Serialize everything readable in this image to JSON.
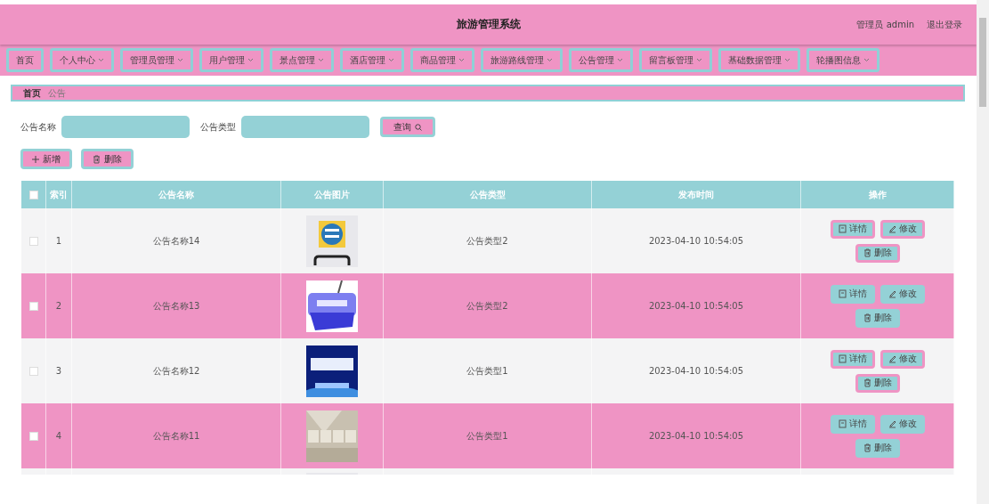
{
  "header": {
    "title": "旅游管理系统",
    "user": "管理员 admin",
    "logout": "退出登录"
  },
  "nav": [
    {
      "label": "首页",
      "dropdown": false
    },
    {
      "label": "个人中心",
      "dropdown": true
    },
    {
      "label": "管理员管理",
      "dropdown": true
    },
    {
      "label": "用户管理",
      "dropdown": true
    },
    {
      "label": "景点管理",
      "dropdown": true
    },
    {
      "label": "酒店管理",
      "dropdown": true
    },
    {
      "label": "商品管理",
      "dropdown": true
    },
    {
      "label": "旅游路线管理",
      "dropdown": true
    },
    {
      "label": "公告管理",
      "dropdown": true
    },
    {
      "label": "留言板管理",
      "dropdown": true
    },
    {
      "label": "基础数据管理",
      "dropdown": true
    },
    {
      "label": "轮播图信息",
      "dropdown": true
    }
  ],
  "breadcrumb": [
    {
      "label": "首页",
      "selected": false
    },
    {
      "label": "公告",
      "selected": true
    }
  ],
  "search": {
    "fields": [
      {
        "label": "公告名称"
      },
      {
        "label": "公告类型"
      }
    ],
    "button": "查询"
  },
  "actions": {
    "add": "新增",
    "delete": "删除"
  },
  "table": {
    "header_checked": false,
    "columns": [
      "索引",
      "公告名称",
      "公告图片",
      "公告类型",
      "发布时间",
      "操作"
    ],
    "rows": [
      {
        "kind": "full",
        "checked": false,
        "index": "1",
        "name": "公告名称14",
        "type": "公告类型2",
        "time": "2023-04-10 10:54:05",
        "ops": [
          "详情",
          "修改",
          "删除"
        ]
      },
      {
        "kind": "full",
        "checked": false,
        "index": "2",
        "name": "公告名称13",
        "type": "公告类型2",
        "time": "2023-04-10 10:54:05",
        "ops": [
          "详情",
          "修改",
          "删除"
        ]
      },
      {
        "kind": "full",
        "checked": false,
        "index": "3",
        "name": "公告名称12",
        "type": "公告类型1",
        "time": "2023-04-10 10:54:05",
        "ops": [
          "详情",
          "修改",
          "删除"
        ]
      },
      {
        "kind": "full",
        "checked": false,
        "index": "4",
        "name": "公告名称11",
        "type": "公告类型1",
        "time": "2023-04-10 10:54:05",
        "ops": [
          "详情",
          "修改",
          "删除"
        ]
      },
      {
        "kind": "partial"
      }
    ]
  }
}
